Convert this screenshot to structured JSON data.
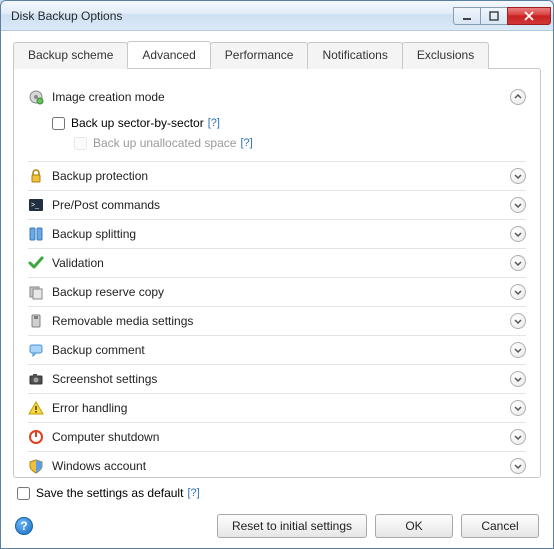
{
  "window": {
    "title": "Disk Backup Options"
  },
  "tabs": [
    {
      "label": "Backup scheme",
      "active": false
    },
    {
      "label": "Advanced",
      "active": true
    },
    {
      "label": "Performance",
      "active": false
    },
    {
      "label": "Notifications",
      "active": false
    },
    {
      "label": "Exclusions",
      "active": false
    }
  ],
  "sections": [
    {
      "icon": "image-mode-icon",
      "title": "Image creation mode",
      "expanded": true,
      "body": {
        "sector_label": "Back up sector-by-sector",
        "sector_checked": false,
        "unalloc_label": "Back up unallocated space",
        "unalloc_checked": false,
        "unalloc_disabled": true
      }
    },
    {
      "icon": "lock-icon",
      "title": "Backup protection",
      "expanded": false
    },
    {
      "icon": "terminal-icon",
      "title": "Pre/Post commands",
      "expanded": false
    },
    {
      "icon": "split-icon",
      "title": "Backup splitting",
      "expanded": false
    },
    {
      "icon": "check-icon",
      "title": "Validation",
      "expanded": false
    },
    {
      "icon": "reserve-icon",
      "title": "Backup reserve copy",
      "expanded": false
    },
    {
      "icon": "removable-icon",
      "title": "Removable media settings",
      "expanded": false
    },
    {
      "icon": "comment-icon",
      "title": "Backup comment",
      "expanded": false
    },
    {
      "icon": "camera-icon",
      "title": "Screenshot settings",
      "expanded": false
    },
    {
      "icon": "warning-icon",
      "title": "Error handling",
      "expanded": false
    },
    {
      "icon": "power-icon",
      "title": "Computer shutdown",
      "expanded": false
    },
    {
      "icon": "shield-icon",
      "title": "Windows account",
      "expanded": false
    }
  ],
  "save_default": {
    "label": "Save the settings as default",
    "checked": false
  },
  "footer": {
    "reset": "Reset to initial settings",
    "ok": "OK",
    "cancel": "Cancel"
  },
  "help_glyph": "[?]"
}
